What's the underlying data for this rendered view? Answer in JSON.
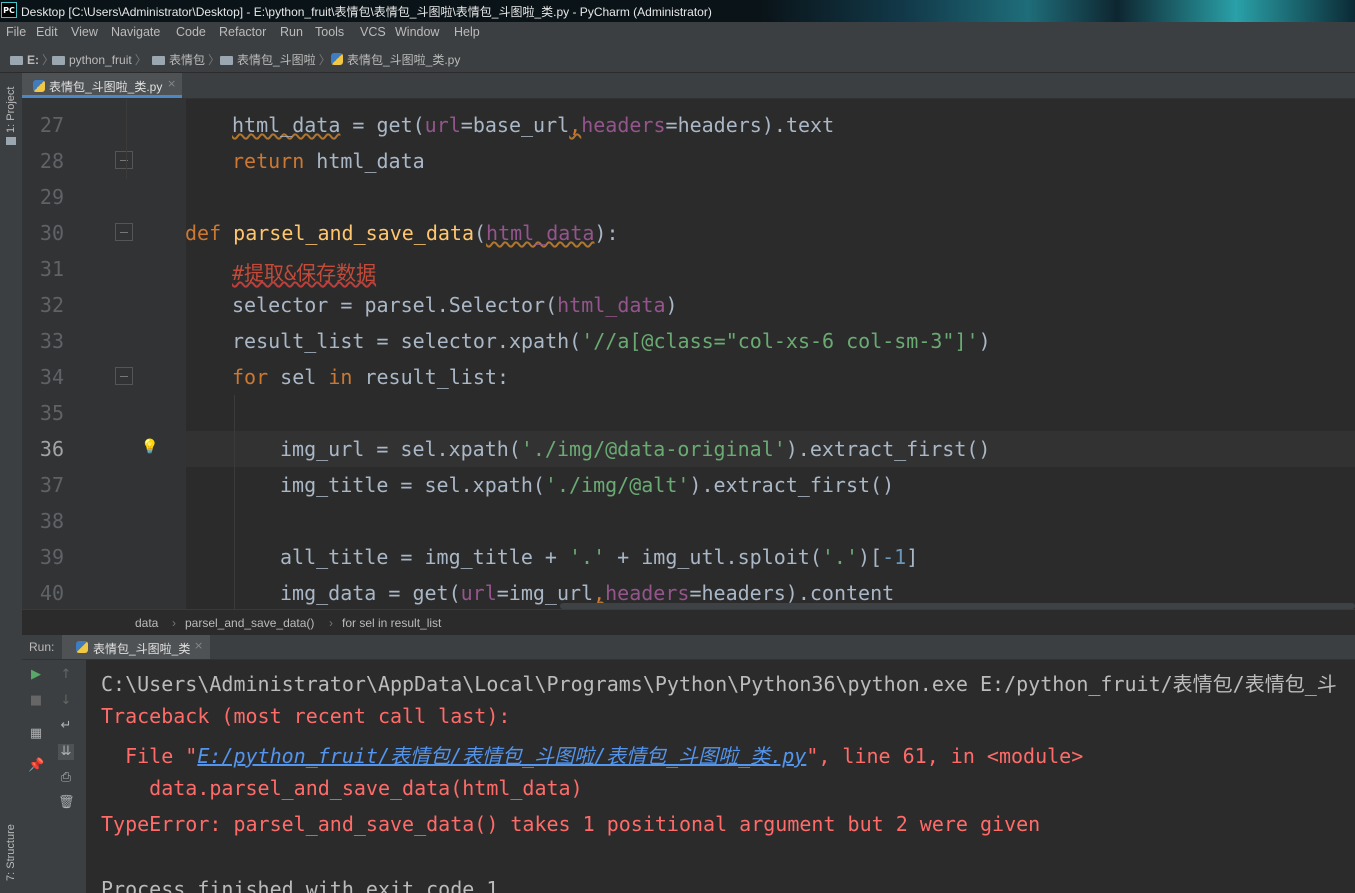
{
  "window": {
    "icon_text": "PC",
    "title": "Desktop [C:\\Users\\Administrator\\Desktop] - E:\\python_fruit\\表情包\\表情包_斗图啦\\表情包_斗图啦_类.py - PyCharm (Administrator)"
  },
  "menu": [
    "File",
    "Edit",
    "View",
    "Navigate",
    "Code",
    "Refactor",
    "Run",
    "Tools",
    "VCS",
    "Window",
    "Help"
  ],
  "navbar": {
    "crumbs": [
      "E:",
      "python_fruit",
      "表情包",
      "表情包_斗图啦",
      "表情包_斗图啦_类.py"
    ]
  },
  "left_stripe": {
    "project": "1: Project",
    "structure": "7: Structure"
  },
  "editor_tab": {
    "label": "表情包_斗图啦_类.py",
    "close": "×"
  },
  "editor": {
    "current_line": 36,
    "line_numbers": [
      "27",
      "28",
      "29",
      "30",
      "31",
      "32",
      "33",
      "34",
      "35",
      "36",
      "37",
      "38",
      "39",
      "40"
    ],
    "lines": [
      "html_data = get(url=base_url,headers=headers).text",
      "return html_data",
      "",
      "def parsel_and_save_data(html_data):",
      "#提取&保存数据",
      "selector = parsel.Selector(html_data)",
      "result_list = selector.xpath('//a[@class=\"col-xs-6 col-sm-3\"]')",
      "for sel in result_list:",
      "",
      "img_url = sel.xpath('./img/@data-original').extract_first()",
      "img_title = sel.xpath('./img/@alt').extract_first()",
      "",
      "all_title = img_title + '.' + img_utl.sploit('.')[-1]",
      "img_data = get(url=img_url,headers=headers).content"
    ],
    "tokens": {
      "html_data": "html_data",
      "eq": " = ",
      "get": "get",
      "lp": "(",
      "rp": ")",
      "url": "url",
      "eq2": "=",
      "base_url": "base_url",
      "comma": ",",
      "headers": "headers",
      "dot_text": ".text",
      "return": "return",
      "sp": " ",
      "def": "def",
      "fname": "parsel_and_save_data",
      "colon": ":",
      "comment": "#提取&保存数据",
      "selector": "selector",
      "parsel_sel": "parsel.Selector",
      "result_list": "result_list",
      "selector_xpath": "selector.xpath",
      "xpath_str": "'//a[@class=\"col-xs-6 col-sm-3\"]'",
      "for": "for",
      "sel": " sel ",
      "in": "in",
      "result_list2": " result_list",
      "img_url": "img_url",
      "sel_xpath": "sel.xpath",
      "str_orig": "'./img/@data-original'",
      "extract": ".extract_first",
      "empty_call": "()",
      "img_title": "img_title",
      "str_alt": "'./img/@alt'",
      "all_title": "all_title",
      "plus_dot": " + ",
      "str_dot": "'.'",
      "img_utl_sploit": "img_utl.sploit",
      "lb": "[",
      "neg1": "-1",
      "rb": "]",
      "img_data": "img_data",
      "dot_content": ".content"
    }
  },
  "editor_breadcrumb": [
    "data",
    "parsel_and_save_data()",
    "for sel in result_list"
  ],
  "run_panel": {
    "label": "Run:",
    "tab_label": "表情包_斗图啦_类",
    "close": "×"
  },
  "console": {
    "lines": [
      "C:\\Users\\Administrator\\AppData\\Local\\Programs\\Python\\Python36\\python.exe E:/python_fruit/表情包/表情包_斗",
      "Traceback (most recent call last):",
      "",
      "    data.parsel_and_save_data(html_data)",
      "TypeError: parsel_and_save_data() takes 1 positional argument but 2 were given",
      "",
      "Process finished with exit code 1"
    ],
    "file_prefix": "  File \"",
    "file_link": "E:/python_fruit/表情包/表情包_斗图啦/表情包_斗图啦_类.py",
    "file_suffix": "\", line 61, in <module>"
  },
  "colors": {
    "background": "#2b2b2b",
    "keyword": "#cc7832",
    "function": "#ffc66d",
    "string": "#6a8759",
    "error": "#ff6b68",
    "link": "#5394ec"
  }
}
